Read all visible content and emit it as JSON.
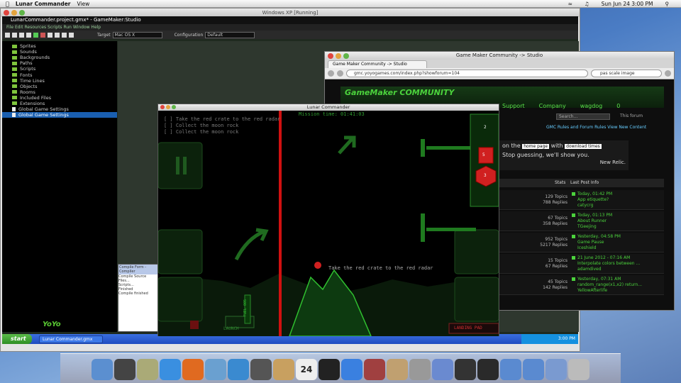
{
  "menubar": {
    "apple": "",
    "app": "Lunar Commander",
    "menu_view": "View",
    "clock": "Sun Jun 24  3:00 PM"
  },
  "vm": {
    "title": "Windows XP [Running]"
  },
  "gm": {
    "title": "LunarCommander.project.gmx* - GameMaker:Studio",
    "menu": "File  Edit  Resources  Scripts  Run  Window  Help",
    "target_label": "Target",
    "target_value": "Mac OS X",
    "config_label": "Configuration",
    "config_value": "Default",
    "tree": [
      "Sprites",
      "Sounds",
      "Backgrounds",
      "Paths",
      "Scripts",
      "Fonts",
      "Time Lines",
      "Objects",
      "Rooms",
      "Included Files",
      "Extensions",
      "Global Game Settings",
      "Global Game Settings"
    ],
    "compile_title": "Compile Form - Compiler",
    "compile_lines": [
      "Compile Source Files...",
      "Scripts...",
      "Finished",
      "Compile finished"
    ],
    "logo": "YoYo"
  },
  "xp": {
    "start": "start",
    "task": "Lunar Commander.gmx",
    "clock": "3:00 PM"
  },
  "ff": {
    "title": "Game Maker Community -> Studio",
    "tab": "Game Maker Community -> Studio",
    "url": "gmc.yoyogames.com/index.php?showforum=104",
    "search": "pas scale image",
    "site_logo": "GameMaker COMMUNITY",
    "nav": [
      "Support",
      "Company",
      "wagdog",
      "0"
    ],
    "search_field": "Search...",
    "forum_label": "This forum",
    "rules": "GMC Rules and Forum Rules  View New Content",
    "ad_pre": "on the",
    "ad_select": "home page",
    "ad_mid": "with",
    "ad_select2": "download times",
    "ad_line": "Stop guessing, we'll show you.",
    "ad_brand": "New Relic.",
    "col_stats": "Stats",
    "col_last": "Last Post Info",
    "rows": [
      {
        "topics": "129 Topics",
        "replies": "788 Replies",
        "date": "Today, 01:42 PM",
        "in": "App etiquette?",
        "by": "catycrg"
      },
      {
        "topics": "67 Topics",
        "replies": "358 Replies",
        "date": "Today, 01:13 PM",
        "in": "About Runner",
        "by": "TGeejing"
      },
      {
        "topics": "952 Topics",
        "replies": "5217 Replies",
        "date": "Yesterday, 04:58 PM",
        "in": "Game Pause",
        "by": "Iceshield"
      },
      {
        "topics": "15 Topics",
        "replies": "67 Replies",
        "date": "21 June 2012 - 07:16 AM",
        "in": "Interpolate colors between ...",
        "by": "adamdived"
      },
      {
        "topics": "45 Topics",
        "replies": "142 Replies",
        "date": "Yesterday, 07:31 AM",
        "in": "random_range(x1,x2) return...",
        "by": "YellowAfterlife"
      }
    ]
  },
  "lm": {
    "title": "Lunar Commander",
    "mission_time": "Mission time: 01:41:03",
    "objectives": [
      "[ ] Take the red crate to the red radar",
      "[ ] Collect the moon rock",
      "[ ] Collect the moon rock"
    ],
    "hint": "Take the red crate to the red radar",
    "launch": "LAUNCH",
    "fuel": "FUEL 005",
    "landing_pad": "LANDING PAD",
    "pod_counts": [
      "2",
      "5",
      "3"
    ]
  },
  "dock": {
    "icons": [
      "finder",
      "launchpad",
      "photo",
      "appstore",
      "firefox",
      "mail",
      "safari",
      "facetime",
      "contacts",
      "calendar",
      "terminal",
      "itunes",
      "photobooth",
      "preview",
      "settings",
      "vbox",
      "monitor",
      "yoyo",
      "folder",
      "folder",
      "downloads",
      "trash"
    ],
    "calendar_day": "24"
  }
}
